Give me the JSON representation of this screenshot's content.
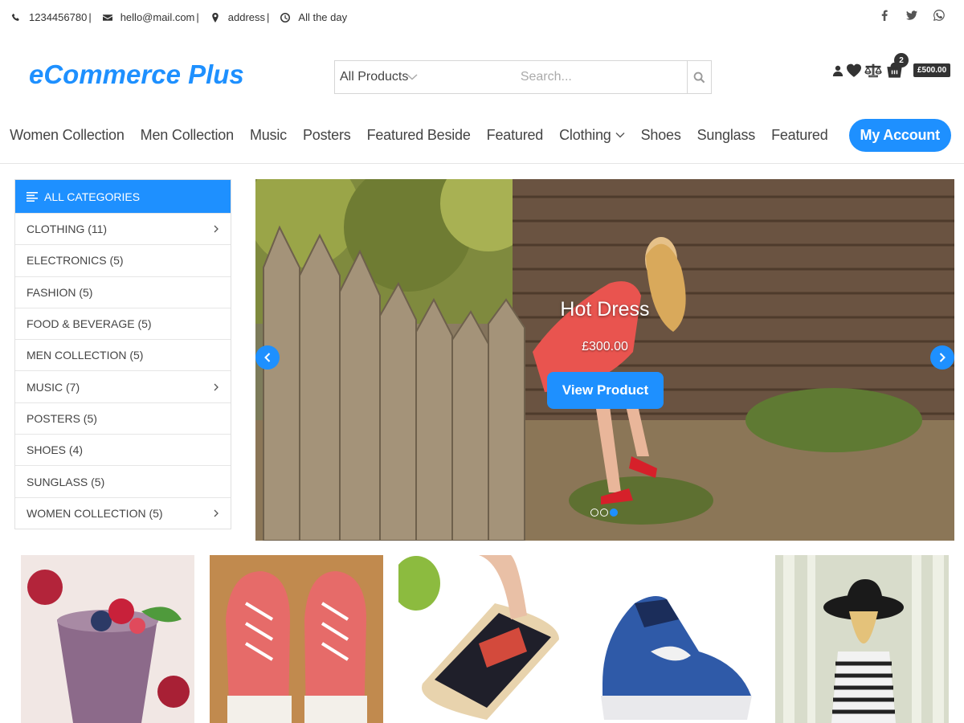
{
  "topbar": {
    "phone": "1234456780",
    "email": "hello@mail.com",
    "address": "address",
    "hours": "All the day",
    "separator": "|"
  },
  "header": {
    "logo": "eCommerce Plus",
    "search_category": "All Products",
    "search_placeholder": "Search...",
    "cart_count": "2",
    "cart_total": "£500.00"
  },
  "nav": {
    "items": [
      "Women Collection",
      "Men Collection",
      "Music",
      "Posters",
      "Featured Beside",
      "Featured",
      "Clothing",
      "Shoes",
      "Sunglass",
      "Featured"
    ],
    "account": "My Account"
  },
  "sidebar": {
    "title": "ALL CATEGORIES",
    "categories": [
      "CLOTHING (11)",
      "ELECTRONICS (5)",
      "FASHION (5)",
      "FOOD & BEVERAGE (5)",
      "MEN COLLECTION (5)",
      "MUSIC (7)",
      "POSTERS (5)",
      "SHOES (4)",
      "SUNGLASS (5)",
      "WOMEN COLLECTION (5)"
    ]
  },
  "hero": {
    "title": "Hot Dress",
    "price": "£300.00",
    "button": "View Product"
  },
  "colors": {
    "accent": "#1e90ff",
    "text": "#444444",
    "dark": "#333333"
  }
}
